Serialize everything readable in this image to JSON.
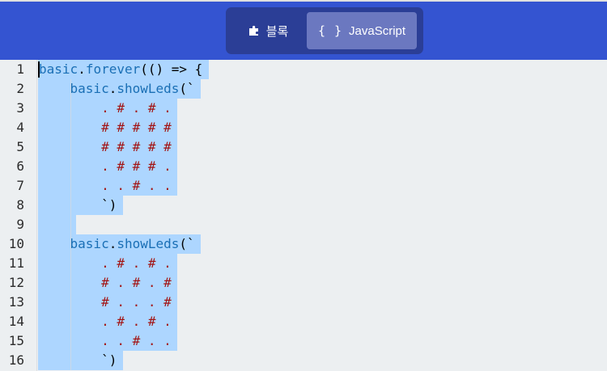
{
  "header": {
    "tabs": [
      {
        "label": "블록",
        "icon": "puzzle-icon",
        "active": false
      },
      {
        "label": "JavaScript",
        "icon": "braces-icon",
        "active": true
      }
    ],
    "braces_glyph": "{ }"
  },
  "colors": {
    "header_bg": "#3454d1",
    "toggle_bg": "#2b3e96",
    "active_tab_bg": "#6b78c0",
    "selection": "#add6ff",
    "keyword": "#1a6fb5",
    "string": "#a31515"
  },
  "editor": {
    "lines": [
      {
        "n": "1",
        "parts": [
          [
            "kw",
            "basic"
          ],
          [
            "p",
            "."
          ],
          [
            "kw",
            "forever"
          ],
          [
            "p",
            "(() => {"
          ]
        ]
      },
      {
        "n": "2",
        "parts": [
          [
            "p",
            "    "
          ],
          [
            "kw",
            "basic"
          ],
          [
            "p",
            "."
          ],
          [
            "kw",
            "showLeds"
          ],
          [
            "p",
            "(`"
          ]
        ]
      },
      {
        "n": "3",
        "parts": [
          [
            "str",
            "        . # . # ."
          ]
        ]
      },
      {
        "n": "4",
        "parts": [
          [
            "str",
            "        # # # # #"
          ]
        ]
      },
      {
        "n": "5",
        "parts": [
          [
            "str",
            "        # # # # #"
          ]
        ]
      },
      {
        "n": "6",
        "parts": [
          [
            "str",
            "        . # # # ."
          ]
        ]
      },
      {
        "n": "7",
        "parts": [
          [
            "str",
            "        . . # . ."
          ]
        ]
      },
      {
        "n": "8",
        "parts": [
          [
            "p",
            "        `)"
          ]
        ]
      },
      {
        "n": "9",
        "parts": [
          [
            "p",
            "    "
          ]
        ]
      },
      {
        "n": "10",
        "parts": [
          [
            "p",
            "    "
          ],
          [
            "kw",
            "basic"
          ],
          [
            "p",
            "."
          ],
          [
            "kw",
            "showLeds"
          ],
          [
            "p",
            "(`"
          ]
        ]
      },
      {
        "n": "11",
        "parts": [
          [
            "str",
            "        . # . # ."
          ]
        ]
      },
      {
        "n": "12",
        "parts": [
          [
            "str",
            "        # . # . #"
          ]
        ]
      },
      {
        "n": "13",
        "parts": [
          [
            "str",
            "        # . . . #"
          ]
        ]
      },
      {
        "n": "14",
        "parts": [
          [
            "str",
            "        . # . # ."
          ]
        ]
      },
      {
        "n": "15",
        "parts": [
          [
            "str",
            "        . . # . ."
          ]
        ]
      },
      {
        "n": "16",
        "parts": [
          [
            "p",
            "        `)"
          ]
        ]
      }
    ]
  }
}
